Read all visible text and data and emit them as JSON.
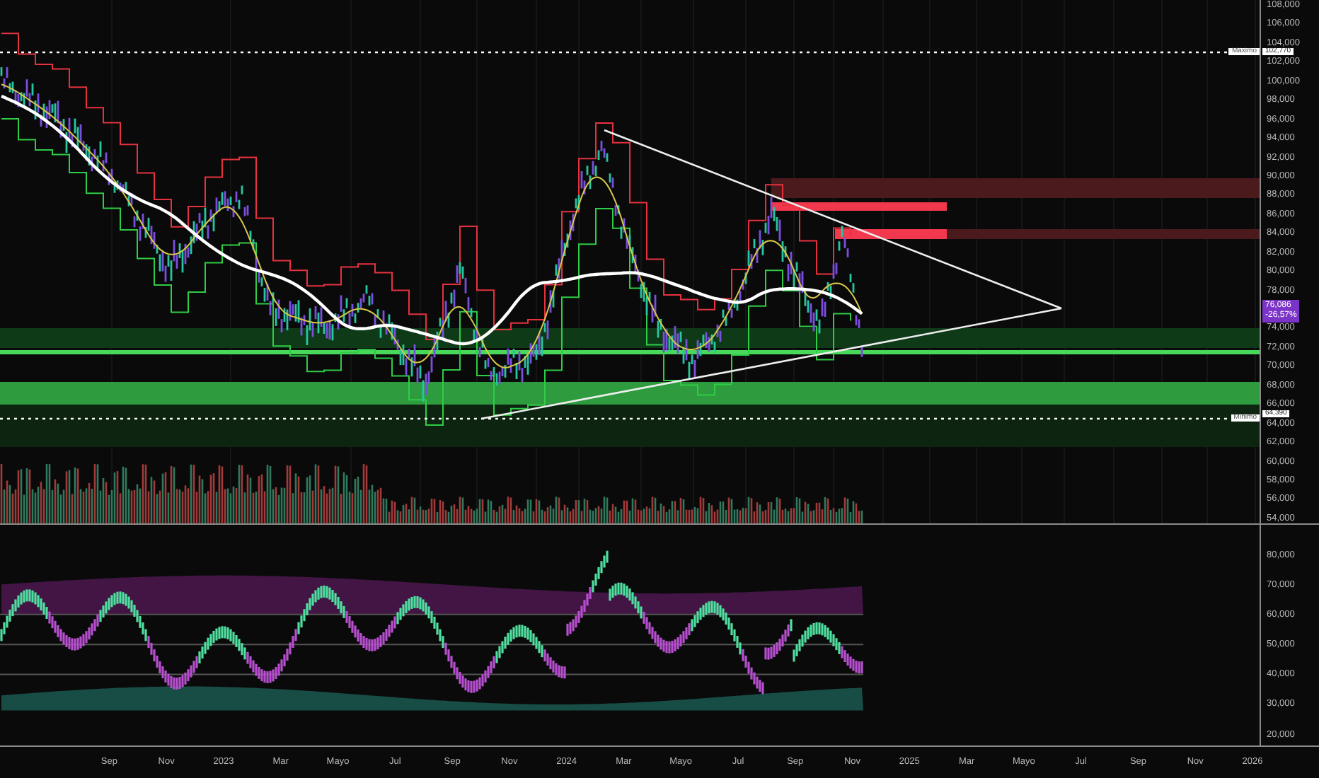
{
  "price_axis": {
    "ticks": [
      "108,000",
      "106,000",
      "104,000",
      "102,000",
      "100,000",
      "98,000",
      "96,000",
      "94,000",
      "92,000",
      "90,000",
      "88,000",
      "86,000",
      "84,000",
      "82,000",
      "80,000",
      "78,000",
      "74,000",
      "72,000",
      "70,000",
      "68,000",
      "66,000",
      "64,000",
      "62,000",
      "60,000",
      "58,000",
      "56,000",
      "54,000"
    ]
  },
  "high_marker": {
    "label": "Máximo",
    "value": "102,770"
  },
  "low_marker": {
    "label": "Mínimo",
    "value": "64,390"
  },
  "last_price": {
    "value": "76,086",
    "change": "-26,57%"
  },
  "oscillator_axis": {
    "ticks": [
      "80,000",
      "70,000",
      "60,000",
      "50,000",
      "40,000",
      "30,000",
      "20,000"
    ]
  },
  "time_axis": {
    "labels": [
      "Sep",
      "Nov",
      "2023",
      "Mar",
      "Mayo",
      "Jul",
      "Sep",
      "Nov",
      "2024",
      "Mar",
      "Mayo",
      "Jul",
      "Sep",
      "Nov",
      "2025",
      "Mar",
      "Mayo",
      "Jul",
      "Sep",
      "Nov",
      "2026"
    ]
  }
}
